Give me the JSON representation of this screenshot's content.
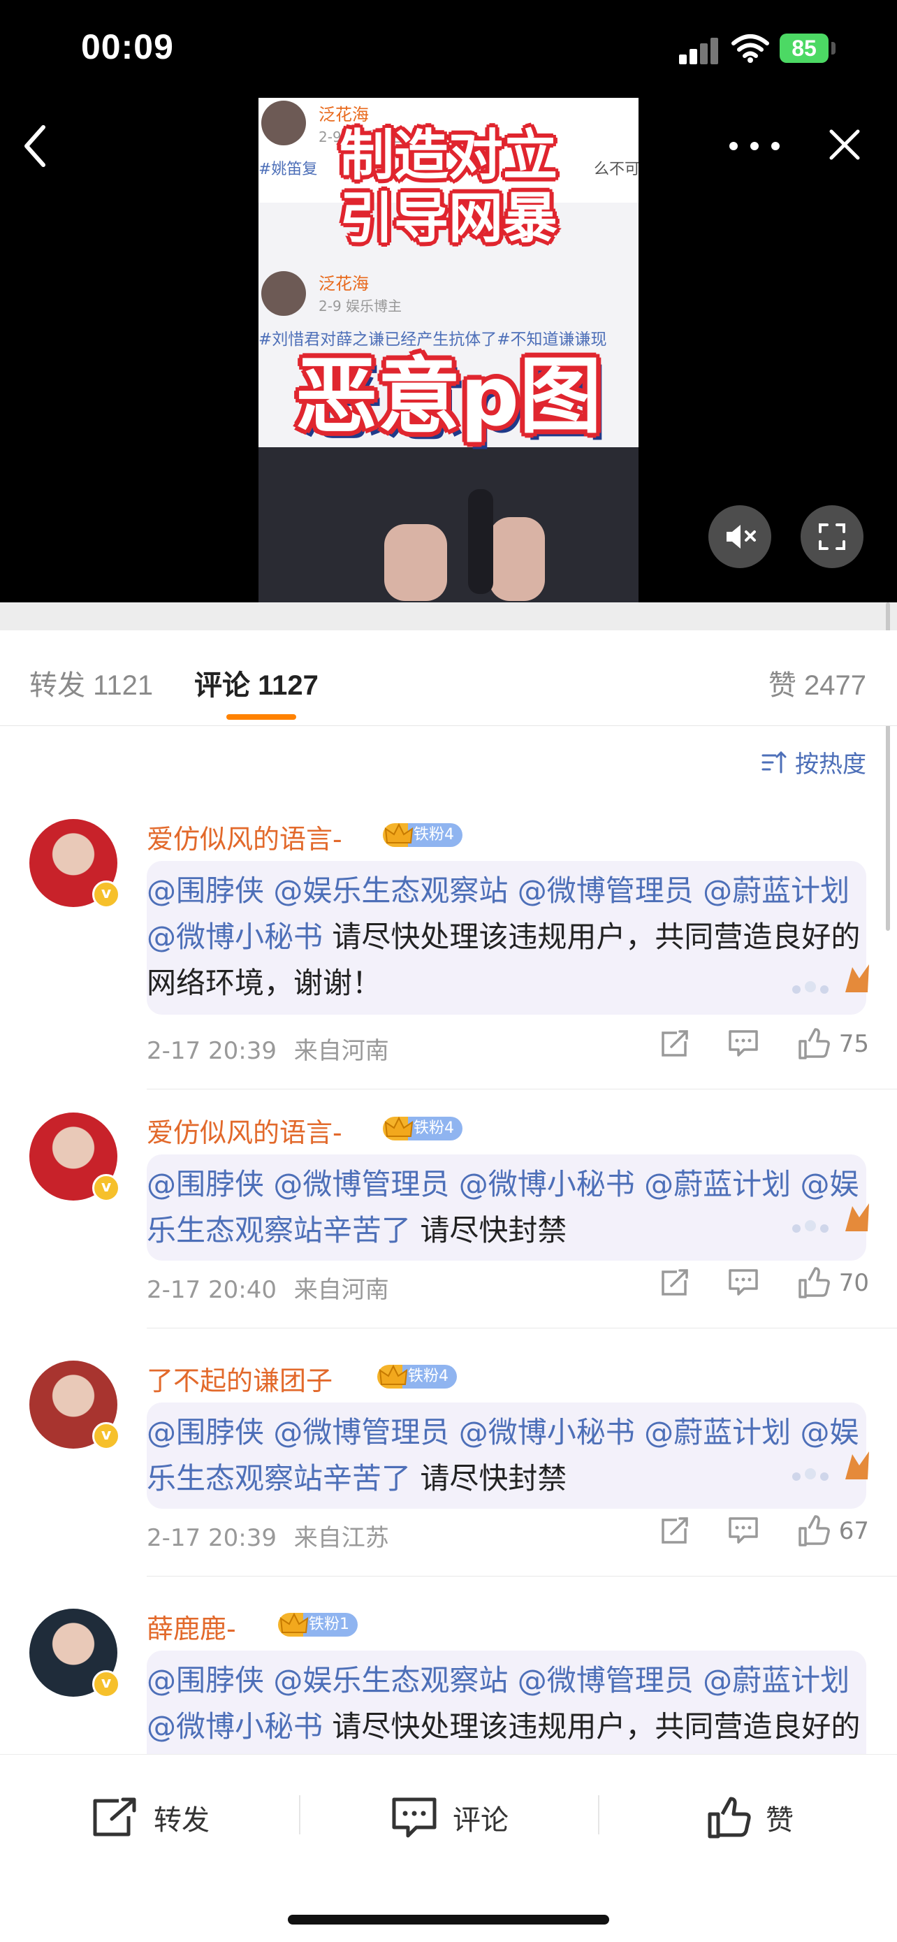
{
  "status_bar": {
    "time": "00:09",
    "battery": "85"
  },
  "video": {
    "screenshot_lines": [
      {
        "name": "泛花海",
        "meta": "2-9 娱乐博主",
        "tags": "#姚笛复",
        "tail": "么不可"
      },
      {
        "name": "泛花海",
        "meta": "2-9 娱乐博主",
        "tags": "#刘惜君对薛之谦已经产生抗体了#不知道谦谦现"
      }
    ],
    "caption_top": "制造对立\n引导网暴",
    "caption_big": "恶意p图"
  },
  "tabs": {
    "repost": "转发 1121",
    "comment": "评论 1127",
    "like": "赞 2477"
  },
  "sort_label": "按热度",
  "comments": [
    {
      "user": "爱仿似风的语言-",
      "fan_badge": "铁粉4",
      "segments": [
        {
          "t": "@围脖侠 ",
          "at": true
        },
        {
          "t": "@娱乐生态观察站 ",
          "at": true
        },
        {
          "t": "@微博管理员 ",
          "at": true
        },
        {
          "t": "@蔚蓝计划 ",
          "at": true
        },
        {
          "t": "@微博小秘书",
          "at": true
        },
        {
          "t": "  请尽快处理该违规用户，共同营造良好的网络环境，谢谢！",
          "at": false
        }
      ],
      "time": "2-17 20:39",
      "location": "来自河南",
      "likes": "75",
      "avatar_color": "#c8222a"
    },
    {
      "user": "爱仿似风的语言-",
      "fan_badge": "铁粉4",
      "segments": [
        {
          "t": "@围脖侠 ",
          "at": true
        },
        {
          "t": "@微博管理员 ",
          "at": true
        },
        {
          "t": "@微博小秘书 ",
          "at": true
        },
        {
          "t": "@蔚蓝计划 ",
          "at": true
        },
        {
          "t": "@娱乐生态观察站辛苦了",
          "at": true
        },
        {
          "t": " 请尽快封禁",
          "at": false
        }
      ],
      "time": "2-17 20:40",
      "location": "来自河南",
      "likes": "70",
      "avatar_color": "#c8222a"
    },
    {
      "user": "了不起的谦团子",
      "fan_badge": "铁粉4",
      "segments": [
        {
          "t": "@围脖侠 ",
          "at": true
        },
        {
          "t": "@微博管理员 ",
          "at": true
        },
        {
          "t": "@微博小秘书 ",
          "at": true
        },
        {
          "t": "@蔚蓝计划 ",
          "at": true
        },
        {
          "t": "@娱乐生态观察站辛苦了",
          "at": true
        },
        {
          "t": " 请尽快封禁",
          "at": false
        }
      ],
      "time": "2-17 20:39",
      "location": "来自江苏",
      "likes": "67",
      "avatar_color": "#a8342f"
    },
    {
      "user": "薛鹿鹿-",
      "fan_badge": "铁粉1",
      "segments": [
        {
          "t": "@围脖侠 ",
          "at": true
        },
        {
          "t": "@娱乐生态观察站 ",
          "at": true
        },
        {
          "t": "@微博管理员 ",
          "at": true
        },
        {
          "t": "@蔚蓝计划 ",
          "at": true
        },
        {
          "t": "@微博小秘书",
          "at": true
        },
        {
          "t": "  请尽快处理该违规用户，共同营造良好的网络环境",
          "at": false
        }
      ],
      "avatar_color": "#1f2c3a"
    }
  ],
  "bottom_bar": {
    "repost": "转发",
    "comment": "评论",
    "like": "赞"
  },
  "colors": {
    "accent": "#ff8200",
    "link": "#4d6fb8",
    "username": "#e2692b"
  }
}
